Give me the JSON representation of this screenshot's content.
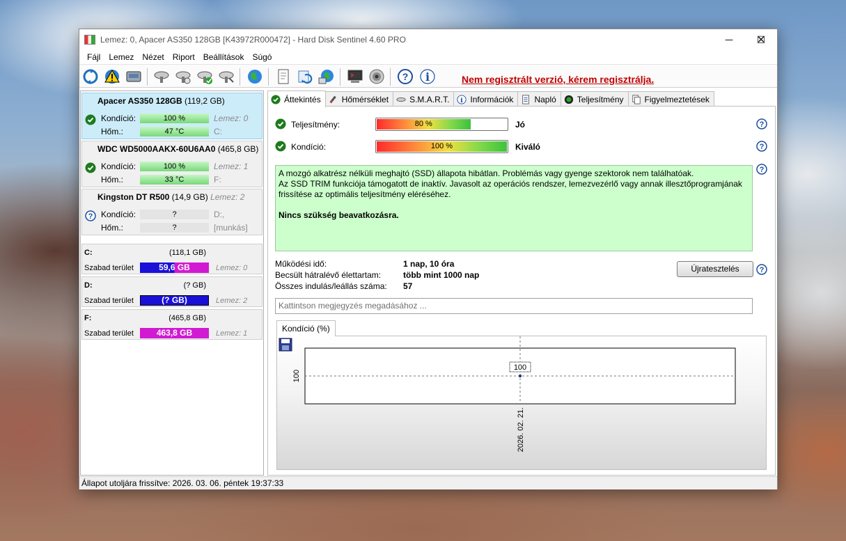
{
  "window": {
    "title": "Lemez: 0, Apacer AS350 128GB [K43972R000472]  -  Hard Disk Sentinel 4.60 PRO",
    "controls": {
      "minimize": "─",
      "maximize": "☐",
      "close": "✕"
    }
  },
  "menu": [
    "Fájl",
    "Lemez",
    "Nézet",
    "Riport",
    "Beállítások",
    "Súgó"
  ],
  "toolbar": {
    "icons": [
      "refresh-icon",
      "alert-icon",
      "drive-icon",
      "disk-test-icon",
      "disk-test-2-icon",
      "disk-ok-icon",
      "disk-settings-icon",
      "web-globe-icon",
      "report-icon",
      "sync-icon",
      "network-icon",
      "terminal-icon",
      "sound-icon",
      "help-icon",
      "info-icon"
    ],
    "registration_notice": "Nem regisztrált verzió, kérem regisztrálja."
  },
  "disks": [
    {
      "name": "Apacer AS350 128GB",
      "size": "(119,2 GB)",
      "status_icon": "check-icon",
      "condition_label": "Kondíció:",
      "condition_value": "100 %",
      "condition_level": 1.0,
      "condition_side": "Lemez: 0",
      "temp_label": "Hőm.:",
      "temp_value": "47 °C",
      "temp_side": "C:",
      "selected": true
    },
    {
      "name": "WDC WD5000AAKX-60U6AA0",
      "size": "(465,8 GB)",
      "status_icon": "check-icon",
      "condition_label": "Kondíció:",
      "condition_value": "100 %",
      "condition_level": 1.0,
      "condition_side": "Lemez: 1",
      "temp_label": "Hőm.:",
      "temp_value": "33 °C",
      "temp_side": "F:",
      "selected": false
    },
    {
      "name": "Kingston DT R500",
      "size": "(14,9 GB)",
      "disk_label": "Lemez: 2",
      "status_icon": "question-icon",
      "condition_label": "Kondíció:",
      "condition_value": "?",
      "condition_side": "D:,",
      "temp_label": "Hőm.:",
      "temp_value": "?",
      "temp_side": "[munkás]",
      "selected": false
    }
  ],
  "volumes": [
    {
      "letter": "C:",
      "size": "(118,1 GB)",
      "free_label": "Szabad terület",
      "free_value": "59,6 GB",
      "free_fraction": 0.5,
      "disk": "Lemez: 0",
      "color": "#1a10d8",
      "fill_color": "#d21ad2"
    },
    {
      "letter": "D:",
      "size": "(? GB)",
      "free_label": "Szabad terület",
      "free_value": "(? GB)",
      "free_fraction": 0.0,
      "disk": "Lemez: 2",
      "color": "#1a10d8",
      "fill_color": "#d21ad2"
    },
    {
      "letter": "F:",
      "size": "(465,8 GB)",
      "free_label": "Szabad terület",
      "free_value": "463,8 GB",
      "free_fraction": 1.0,
      "disk": "Lemez: 1",
      "color": "#1a10d8",
      "fill_color": "#d21ad2"
    }
  ],
  "tabs": [
    "Áttekintés",
    "Hőmérséklet",
    "S.M.A.R.T.",
    "Információk",
    "Napló",
    "Teljesítmény",
    "Figyelmeztetések"
  ],
  "overview": {
    "performance_label": "Teljesítmény:",
    "performance_value": "80 %",
    "performance_level": 0.8,
    "performance_rating": "Jó",
    "condition_label": "Kondíció:",
    "condition_value": "100 %",
    "condition_level": 1.0,
    "condition_rating": "Kiváló",
    "description": [
      "A mozgó alkatrész nélküli meghajtó (SSD) állapota hibátlan. Problémás vagy gyenge szektorok nem találhatóak.",
      "Az SSD TRIM funkciója támogatott de inaktív. Javasolt az operációs rendszer, lemezvezérlő vagy annak illesztőprogramjának",
      "frissítése az optimális teljesítmény eléréséhez."
    ],
    "action": "Nincs szükség beavatkozásra.",
    "uptime_label": "Működési idő:",
    "uptime_value": "1 nap, 10 óra",
    "lifetime_label": "Becsült hátralévő élettartam:",
    "lifetime_value": "több mint 1000 nap",
    "starts_label": "Összes indulás/leállás száma:",
    "starts_value": "57",
    "retest_button": "Újratesztelés",
    "note_placeholder": "Kattintson megjegyzés megadásához ...",
    "chart_tab": "Kondíció  (%)"
  },
  "chart_data": {
    "type": "line",
    "x": [
      "2026. 02. 21."
    ],
    "series": [
      {
        "values": [
          100
        ]
      }
    ],
    "y_tick_labels": [
      "100"
    ],
    "data_labels": [
      "100"
    ],
    "grid": true
  },
  "status": {
    "last_refresh": "Állapot utoljára frissítve: 2026. 03. 06. péntek 19:37:33"
  },
  "colors": {
    "accent_red": "#c00000",
    "bar_green": "#9ee89e",
    "desc_bg": "#ccffcc",
    "selected_bg": "#ccecf9"
  }
}
